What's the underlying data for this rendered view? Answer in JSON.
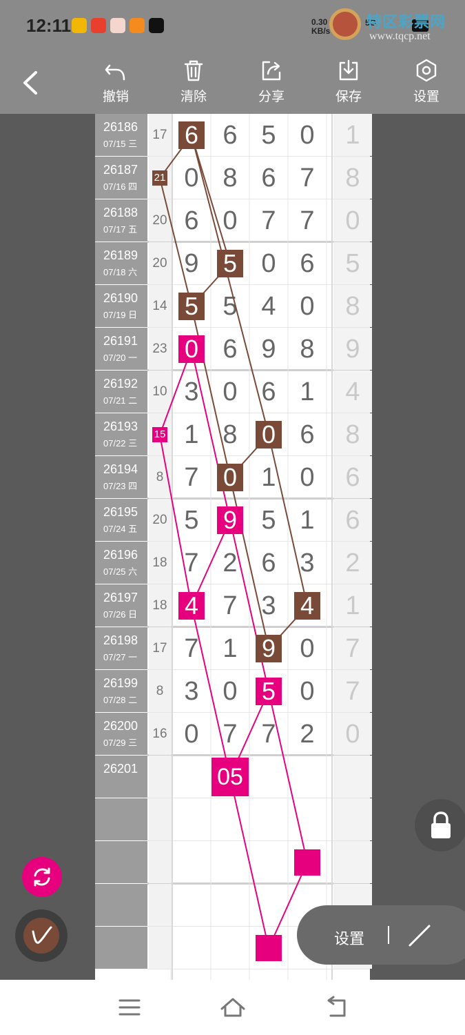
{
  "status_bar": {
    "time": "12:11",
    "net_speed": "0.30",
    "net_unit": "KB/s",
    "network": "5G"
  },
  "watermark": {
    "title": "特区彩票网",
    "url": "www.tqcp.net"
  },
  "toolbar": {
    "undo": "撤销",
    "clear": "清除",
    "share": "分享",
    "save": "保存",
    "settings": "设置"
  },
  "rows": [
    {
      "issue": "26186",
      "date": "07/15 三",
      "sum": "17",
      "digits": [
        "6",
        "6",
        "5",
        "0"
      ],
      "last": "1"
    },
    {
      "issue": "26187",
      "date": "07/16 四",
      "sum": "21",
      "digits": [
        "0",
        "8",
        "6",
        "7"
      ],
      "last": "8"
    },
    {
      "issue": "26188",
      "date": "07/17 五",
      "sum": "20",
      "digits": [
        "6",
        "0",
        "7",
        "7"
      ],
      "last": "0"
    },
    {
      "issue": "26189",
      "date": "07/18 六",
      "sum": "20",
      "digits": [
        "9",
        "5",
        "0",
        "6"
      ],
      "last": "5"
    },
    {
      "issue": "26190",
      "date": "07/19 日",
      "sum": "14",
      "digits": [
        "5",
        "5",
        "4",
        "0"
      ],
      "last": "8"
    },
    {
      "issue": "26191",
      "date": "07/20 一",
      "sum": "23",
      "digits": [
        "0",
        "6",
        "9",
        "8"
      ],
      "last": "9"
    },
    {
      "issue": "26192",
      "date": "07/21 二",
      "sum": "10",
      "digits": [
        "3",
        "0",
        "6",
        "1"
      ],
      "last": "4"
    },
    {
      "issue": "26193",
      "date": "07/22 三",
      "sum": "15",
      "digits": [
        "1",
        "8",
        "0",
        "6"
      ],
      "last": "8"
    },
    {
      "issue": "26194",
      "date": "07/23 四",
      "sum": "8",
      "digits": [
        "7",
        "0",
        "1",
        "0"
      ],
      "last": "6"
    },
    {
      "issue": "26195",
      "date": "07/24 五",
      "sum": "20",
      "digits": [
        "5",
        "9",
        "5",
        "1"
      ],
      "last": "6"
    },
    {
      "issue": "26196",
      "date": "07/25 六",
      "sum": "18",
      "digits": [
        "7",
        "2",
        "6",
        "3"
      ],
      "last": "2"
    },
    {
      "issue": "26197",
      "date": "07/26 日",
      "sum": "18",
      "digits": [
        "4",
        "7",
        "3",
        "4"
      ],
      "last": "1"
    },
    {
      "issue": "26198",
      "date": "07/27 一",
      "sum": "17",
      "digits": [
        "7",
        "1",
        "9",
        "0"
      ],
      "last": "7"
    },
    {
      "issue": "26199",
      "date": "07/28 二",
      "sum": "8",
      "digits": [
        "3",
        "0",
        "5",
        "0"
      ],
      "last": "7"
    },
    {
      "issue": "26200",
      "date": "07/29 三",
      "sum": "16",
      "digits": [
        "0",
        "7",
        "7",
        "2"
      ],
      "last": "0"
    },
    {
      "issue": "26201",
      "date": "",
      "sum": "",
      "digits": [
        "",
        "",
        "",
        ""
      ],
      "last": ""
    },
    {
      "issue": "",
      "date": "",
      "sum": "",
      "digits": [
        "",
        "",
        "",
        ""
      ],
      "last": ""
    },
    {
      "issue": "",
      "date": "",
      "sum": "",
      "digits": [
        "",
        "",
        "",
        ""
      ],
      "last": ""
    },
    {
      "issue": "",
      "date": "",
      "sum": "",
      "digits": [
        "",
        "",
        "",
        ""
      ],
      "last": ""
    },
    {
      "issue": "",
      "date": "",
      "sum": "",
      "digits": [
        "",
        "",
        "",
        ""
      ],
      "last": ""
    }
  ],
  "marks": [
    {
      "color": "brown",
      "row": 0,
      "col": 1,
      "text": "6",
      "kind": "digit"
    },
    {
      "color": "brown",
      "row": 1,
      "col": 0,
      "text": "21",
      "kind": "sum"
    },
    {
      "color": "brown",
      "row": 3,
      "col": 2,
      "text": "5",
      "kind": "digit"
    },
    {
      "color": "brown",
      "row": 4,
      "col": 1,
      "text": "5",
      "kind": "digit"
    },
    {
      "color": "brown",
      "row": 7,
      "col": 3,
      "text": "0",
      "kind": "digit"
    },
    {
      "color": "brown",
      "row": 8,
      "col": 2,
      "text": "0",
      "kind": "digit"
    },
    {
      "color": "brown",
      "row": 11,
      "col": 4,
      "text": "4",
      "kind": "digit"
    },
    {
      "color": "brown",
      "row": 12,
      "col": 3,
      "text": "9",
      "kind": "digit"
    },
    {
      "color": "pink",
      "row": 5,
      "col": 1,
      "text": "0",
      "kind": "digit"
    },
    {
      "color": "pink",
      "row": 7,
      "col": 0,
      "text": "15",
      "kind": "sum"
    },
    {
      "color": "pink",
      "row": 9,
      "col": 2,
      "text": "9",
      "kind": "digit"
    },
    {
      "color": "pink",
      "row": 11,
      "col": 1,
      "text": "4",
      "kind": "digit"
    },
    {
      "color": "pink",
      "row": 13,
      "col": 3,
      "text": "5",
      "kind": "digit"
    },
    {
      "color": "pink",
      "row": 15,
      "col": 2,
      "text": "05",
      "kind": "prediction"
    },
    {
      "color": "pink",
      "row": 17,
      "col": 4,
      "text": "",
      "kind": "prediction"
    },
    {
      "color": "pink",
      "row": 19,
      "col": 3,
      "text": "",
      "kind": "prediction"
    }
  ],
  "lines": {
    "brown": [
      [
        0,
        1,
        1,
        0
      ],
      [
        0,
        1,
        3,
        2
      ],
      [
        3,
        2,
        4,
        1
      ],
      [
        1,
        0,
        4,
        1
      ],
      [
        0,
        1,
        7,
        3
      ],
      [
        7,
        3,
        8,
        2
      ],
      [
        4,
        1,
        8,
        2
      ],
      [
        7,
        3,
        11,
        4
      ],
      [
        8,
        2,
        12,
        3
      ],
      [
        11,
        4,
        12,
        3
      ]
    ],
    "pink": [
      [
        5,
        1,
        7,
        0
      ],
      [
        5,
        1,
        9,
        2
      ],
      [
        7,
        0,
        11,
        1
      ],
      [
        9,
        2,
        11,
        1
      ],
      [
        9,
        2,
        13,
        3
      ],
      [
        11,
        1,
        15,
        2
      ],
      [
        13,
        3,
        15,
        2
      ],
      [
        15,
        2,
        19,
        3
      ],
      [
        13,
        3,
        17,
        4
      ],
      [
        17,
        4,
        19,
        3
      ]
    ]
  },
  "controls": {
    "pill_label": "设置"
  },
  "colors": {
    "brown": "#7a4a38",
    "pink": "#e6007e"
  }
}
